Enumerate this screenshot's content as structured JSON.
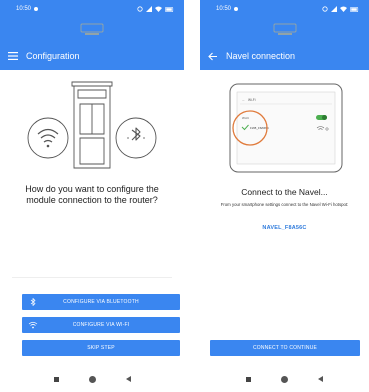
{
  "left_screen": {
    "status_time": "10:50",
    "toolbar_title": "Configuration",
    "question_line1": "How do you want to configure the",
    "question_line2": "module connection to the router?",
    "buttons": {
      "bluetooth": "CONFIGURE VIA BLUETOOTH",
      "wifi": "CONFIGURE VIA WI-FI",
      "skip": "SKIP STEP"
    }
  },
  "right_screen": {
    "status_time": "10:50",
    "toolbar_title": "Navel connection",
    "illustration": {
      "wifi_header": "Wi-Fi",
      "network_name": "FW8_F8A56C"
    },
    "connect_title": "Connect to the Navel...",
    "instruction": "From your smartphone settings connect to the Navel Wi-Fi hotspot:",
    "hotspot_name": "NAVEL_F8A56C",
    "continue_button": "CONNECT TO CONTINUE"
  },
  "colors": {
    "header": "#3a86f0",
    "accent_text": "#2f7bdc",
    "toggle_green": "#4caf50",
    "highlight_circle": "#e07b3c"
  },
  "icons": [
    "menu-icon",
    "back-arrow-icon",
    "wifi-icon",
    "bluetooth-icon",
    "stove-icon",
    "phone-icon",
    "checkmark-icon"
  ]
}
